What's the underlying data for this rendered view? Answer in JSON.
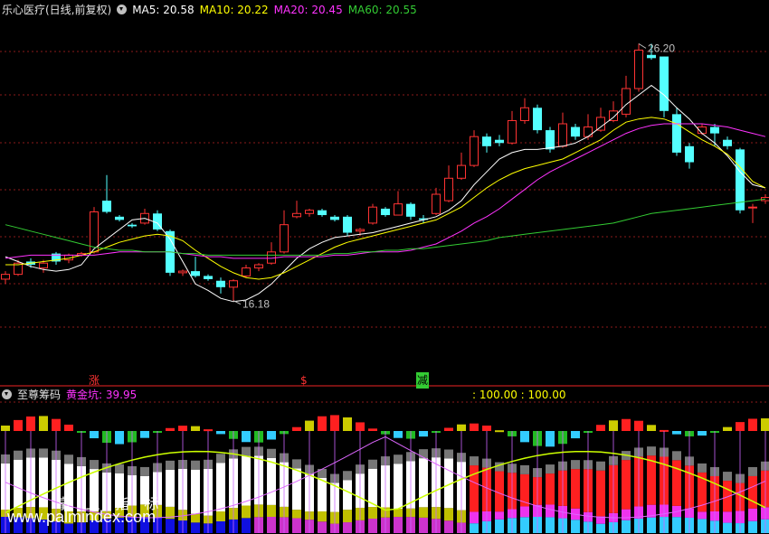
{
  "top_panel": {
    "stock_name": "乐心医疗(日线,前复权)",
    "ma5": "MA5: 20.58",
    "ma10": "MA10: 20.22",
    "ma20": "MA20: 20.45",
    "ma60": "MA60: 20.55"
  },
  "bottom_panel": {
    "indicator_name": "至尊筹码",
    "huangjinkeng": "黄金坑: 39.95",
    "value_readout": ": 100.00 : 100.00"
  },
  "signals": {
    "zhang": "涨",
    "dollar": "$",
    "jian": "减"
  },
  "watermark": {
    "cn": "掌 上 指 标",
    "url": "www.palmindex.com"
  },
  "colors": {
    "up": "#ff3333",
    "down": "#54ffff",
    "ma5": "#ffffff",
    "ma10": "#ffff00",
    "ma20": "#ff33ff",
    "ma60": "#33cc33",
    "grid": "#8b1a1a"
  },
  "chart_data": [
    {
      "type": "candlestick",
      "series": [
        {
          "name": "MA5",
          "values": [
            19.55,
            19.4,
            19.25,
            19.15,
            19.1,
            19.15,
            19.3,
            19.8,
            20.1,
            20.4,
            20.7,
            20.75,
            20.6,
            20.1,
            19.4,
            18.7,
            18.5,
            18.25,
            18.15,
            18.2,
            18.4,
            18.7,
            19.1,
            19.5,
            19.8,
            20.0,
            20.15,
            20.2,
            20.25,
            20.3,
            20.4,
            20.5,
            20.6,
            20.7,
            20.8,
            21.0,
            21.3,
            21.8,
            22.2,
            22.6,
            22.8,
            22.9,
            22.9,
            22.95,
            23.0,
            23.1,
            23.3,
            23.6,
            23.9,
            24.3,
            24.6,
            24.9,
            24.6,
            24.2,
            23.85,
            23.4,
            23.1,
            22.7,
            22.2,
            21.8,
            21.7
          ]
        },
        {
          "name": "MA10",
          "values": [
            19.3,
            19.3,
            19.35,
            19.4,
            19.45,
            19.5,
            19.6,
            19.7,
            19.85,
            20.0,
            20.1,
            20.2,
            20.25,
            20.2,
            20.05,
            19.75,
            19.5,
            19.25,
            19.05,
            18.9,
            18.85,
            18.9,
            19.05,
            19.25,
            19.45,
            19.65,
            19.85,
            20.0,
            20.1,
            20.2,
            20.3,
            20.4,
            20.5,
            20.6,
            20.7,
            20.9,
            21.1,
            21.4,
            21.7,
            21.95,
            22.15,
            22.3,
            22.4,
            22.5,
            22.6,
            22.8,
            23.0,
            23.2,
            23.5,
            23.75,
            23.85,
            23.9,
            23.85,
            23.7,
            23.45,
            23.2,
            23.0,
            22.75,
            22.35,
            21.9,
            21.7
          ]
        },
        {
          "name": "MA20",
          "values": [
            19.5,
            19.55,
            19.6,
            19.6,
            19.6,
            19.6,
            19.6,
            19.6,
            19.65,
            19.7,
            19.7,
            19.7,
            19.7,
            19.7,
            19.65,
            19.6,
            19.55,
            19.55,
            19.5,
            19.5,
            19.5,
            19.5,
            19.55,
            19.55,
            19.55,
            19.55,
            19.6,
            19.6,
            19.65,
            19.7,
            19.7,
            19.7,
            19.75,
            19.85,
            19.95,
            20.15,
            20.35,
            20.6,
            20.8,
            21.05,
            21.35,
            21.65,
            21.95,
            22.2,
            22.4,
            22.6,
            22.8,
            23.0,
            23.2,
            23.4,
            23.55,
            23.65,
            23.7,
            23.7,
            23.7,
            23.7,
            23.65,
            23.6,
            23.5,
            23.4,
            23.3
          ]
        },
        {
          "name": "MA60",
          "values": [
            20.55,
            20.45,
            20.35,
            20.25,
            20.15,
            20.05,
            19.95,
            19.85,
            19.8,
            19.75,
            19.75,
            19.7,
            19.7,
            19.7,
            19.65,
            19.65,
            19.6,
            19.6,
            19.6,
            19.6,
            19.6,
            19.6,
            19.6,
            19.6,
            19.6,
            19.6,
            19.65,
            19.65,
            19.7,
            19.7,
            19.75,
            19.75,
            19.8,
            19.8,
            19.85,
            19.9,
            19.95,
            20.0,
            20.05,
            20.15,
            20.2,
            20.25,
            20.3,
            20.35,
            20.4,
            20.45,
            20.5,
            20.55,
            20.6,
            20.7,
            20.8,
            20.9,
            20.95,
            21.0,
            21.05,
            21.1,
            21.15,
            21.2,
            21.25,
            21.3,
            21.35
          ]
        }
      ],
      "candles": [
        [
          18.85,
          19.0,
          18.7,
          19.1
        ],
        [
          19.0,
          19.35,
          18.95,
          19.45
        ],
        [
          19.4,
          19.3,
          19.2,
          19.5
        ],
        [
          19.2,
          19.35,
          19.05,
          19.45
        ],
        [
          19.65,
          19.4,
          19.3,
          19.7
        ],
        [
          19.45,
          19.6,
          19.35,
          19.65
        ],
        [
          19.6,
          19.65,
          19.55,
          19.7
        ],
        [
          19.7,
          20.95,
          19.65,
          21.1
        ],
        [
          21.3,
          20.95,
          20.9,
          22.1
        ],
        [
          20.8,
          20.7,
          20.65,
          20.85
        ],
        [
          20.55,
          20.5,
          20.45,
          20.6
        ],
        [
          20.6,
          20.9,
          20.55,
          21.05
        ],
        [
          20.9,
          20.4,
          20.35,
          21.0
        ],
        [
          20.35,
          19.05,
          18.95,
          20.4
        ],
        [
          19.05,
          19.1,
          18.95,
          19.15
        ],
        [
          19.1,
          18.95,
          18.9,
          19.55
        ],
        [
          18.95,
          18.85,
          18.8,
          19.0
        ],
        [
          18.8,
          18.6,
          18.4,
          18.9
        ],
        [
          18.6,
          18.8,
          18.18,
          18.85
        ],
        [
          18.95,
          19.2,
          18.9,
          19.3
        ],
        [
          19.2,
          19.3,
          19.1,
          19.35
        ],
        [
          19.35,
          19.7,
          19.3,
          20.0
        ],
        [
          19.7,
          20.55,
          19.65,
          21.0
        ],
        [
          20.8,
          20.9,
          20.75,
          21.3
        ],
        [
          20.9,
          21.0,
          20.8,
          21.05
        ],
        [
          21.0,
          20.85,
          20.8,
          21.05
        ],
        [
          20.8,
          20.7,
          20.65,
          20.85
        ],
        [
          20.8,
          20.3,
          20.2,
          20.85
        ],
        [
          20.35,
          20.4,
          20.2,
          20.45
        ],
        [
          20.6,
          21.1,
          20.55,
          21.2
        ],
        [
          21.05,
          20.85,
          20.8,
          21.1
        ],
        [
          20.85,
          21.2,
          20.85,
          21.6
        ],
        [
          21.2,
          20.8,
          20.7,
          21.25
        ],
        [
          20.75,
          20.7,
          20.6,
          20.85
        ],
        [
          20.9,
          21.5,
          20.85,
          21.7
        ],
        [
          21.3,
          22.0,
          21.25,
          22.4
        ],
        [
          22.0,
          22.4,
          21.95,
          22.8
        ],
        [
          22.4,
          23.3,
          22.35,
          23.5
        ],
        [
          23.3,
          23.0,
          22.8,
          23.4
        ],
        [
          23.2,
          23.1,
          23.0,
          23.35
        ],
        [
          23.1,
          23.8,
          23.05,
          24.1
        ],
        [
          23.8,
          24.2,
          23.7,
          24.5
        ],
        [
          24.2,
          23.5,
          23.4,
          24.3
        ],
        [
          23.5,
          22.9,
          22.8,
          23.6
        ],
        [
          23.0,
          23.7,
          22.95,
          24.05
        ],
        [
          23.6,
          23.3,
          23.2,
          23.7
        ],
        [
          23.3,
          23.6,
          23.2,
          24.0
        ],
        [
          23.5,
          23.9,
          23.45,
          24.2
        ],
        [
          23.8,
          24.1,
          23.75,
          24.4
        ],
        [
          24.0,
          24.8,
          23.9,
          25.2
        ],
        [
          24.8,
          26.0,
          24.7,
          26.2
        ],
        [
          25.85,
          25.75,
          25.7,
          26.2
        ],
        [
          25.8,
          24.1,
          23.9,
          25.8
        ],
        [
          24.0,
          22.8,
          22.7,
          24.2
        ],
        [
          23.0,
          22.5,
          22.3,
          23.1
        ],
        [
          23.4,
          23.6,
          23.35,
          23.7
        ],
        [
          23.6,
          23.4,
          23.0,
          23.7
        ],
        [
          23.2,
          23.0,
          22.9,
          23.3
        ],
        [
          22.9,
          21.0,
          20.9,
          22.95
        ],
        [
          21.1,
          21.1,
          20.6,
          21.2
        ],
        [
          21.3,
          21.4,
          21.2,
          21.5
        ]
      ],
      "annotations": [
        "26.20",
        "16.18"
      ],
      "ylim": [
        16.0,
        27.0
      ]
    },
    {
      "type": "bar",
      "series": [
        {
          "name": "黄金坑",
          "last": 39.95
        }
      ],
      "ylim": [
        0,
        100
      ]
    }
  ]
}
